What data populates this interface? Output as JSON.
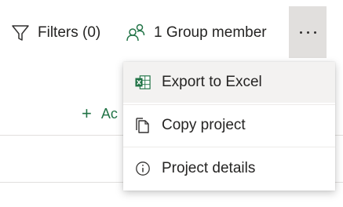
{
  "toolbar": {
    "filters_label": "Filters (0)",
    "group_member_label": "1 Group member",
    "more_icon": "more-horizontal-icon"
  },
  "content": {
    "add_label": "Ac"
  },
  "menu": {
    "items": [
      {
        "label": "Export to Excel",
        "icon": "excel-icon"
      },
      {
        "label": "Copy project",
        "icon": "copy-icon"
      },
      {
        "label": "Project details",
        "icon": "info-icon"
      }
    ]
  },
  "colors": {
    "accent": "#217346",
    "hover_bg": "#f3f2f1",
    "active_button_bg": "#e1dfdd",
    "text": "#252423"
  }
}
